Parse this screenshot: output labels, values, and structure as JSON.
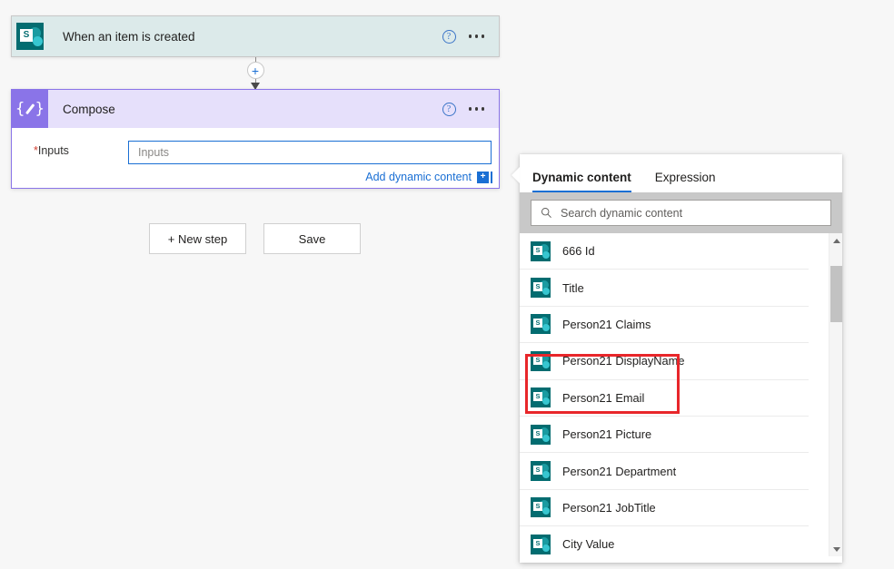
{
  "flow": {
    "trigger_card": {
      "title": "When an item is created",
      "icon": "sharepoint-icon",
      "icon_letter": "S",
      "help_glyph": "?",
      "header_color": "#dceaea"
    },
    "compose_card": {
      "title": "Compose",
      "icon": "compose-braces-pencil-icon",
      "help_glyph": "?",
      "header_color": "#e6e0fb",
      "border_color": "#8a74e8",
      "field": {
        "label": "Inputs",
        "required_marker": "*",
        "value": "",
        "placeholder": "Inputs"
      },
      "add_dynamic_content_label": "Add dynamic content",
      "add_dynamic_content_badge": "+"
    },
    "connector": {
      "plus_glyph": "+"
    },
    "buttons": {
      "new_step": "+ New step",
      "save": "Save"
    }
  },
  "dynamic_panel": {
    "tabs": [
      {
        "label": "Dynamic content",
        "active": true
      },
      {
        "label": "Expression",
        "active": false
      }
    ],
    "search": {
      "placeholder": "Search dynamic content",
      "value": "",
      "icon": "search-icon"
    },
    "items": [
      {
        "label": "666 Id",
        "icon": "sharepoint-icon",
        "highlighted": false
      },
      {
        "label": "Title",
        "icon": "sharepoint-icon",
        "highlighted": false
      },
      {
        "label": "Person21 Claims",
        "icon": "sharepoint-icon",
        "highlighted": false
      },
      {
        "label": "Person21 DisplayName",
        "icon": "sharepoint-icon",
        "highlighted": true
      },
      {
        "label": "Person21 Email",
        "icon": "sharepoint-icon",
        "highlighted": true
      },
      {
        "label": "Person21 Picture",
        "icon": "sharepoint-icon",
        "highlighted": false
      },
      {
        "label": "Person21 Department",
        "icon": "sharepoint-icon",
        "highlighted": false
      },
      {
        "label": "Person21 JobTitle",
        "icon": "sharepoint-icon",
        "highlighted": false
      },
      {
        "label": "City Value",
        "icon": "sharepoint-icon",
        "highlighted": false
      }
    ],
    "scrollbar": {
      "up_arrow": "scroll-up-arrow",
      "down_arrow": "scroll-down-arrow"
    }
  },
  "annotation": {
    "color": "#e8262a",
    "targets": [
      "Person21 DisplayName",
      "Person21 Email"
    ]
  },
  "icon_letter": "S"
}
